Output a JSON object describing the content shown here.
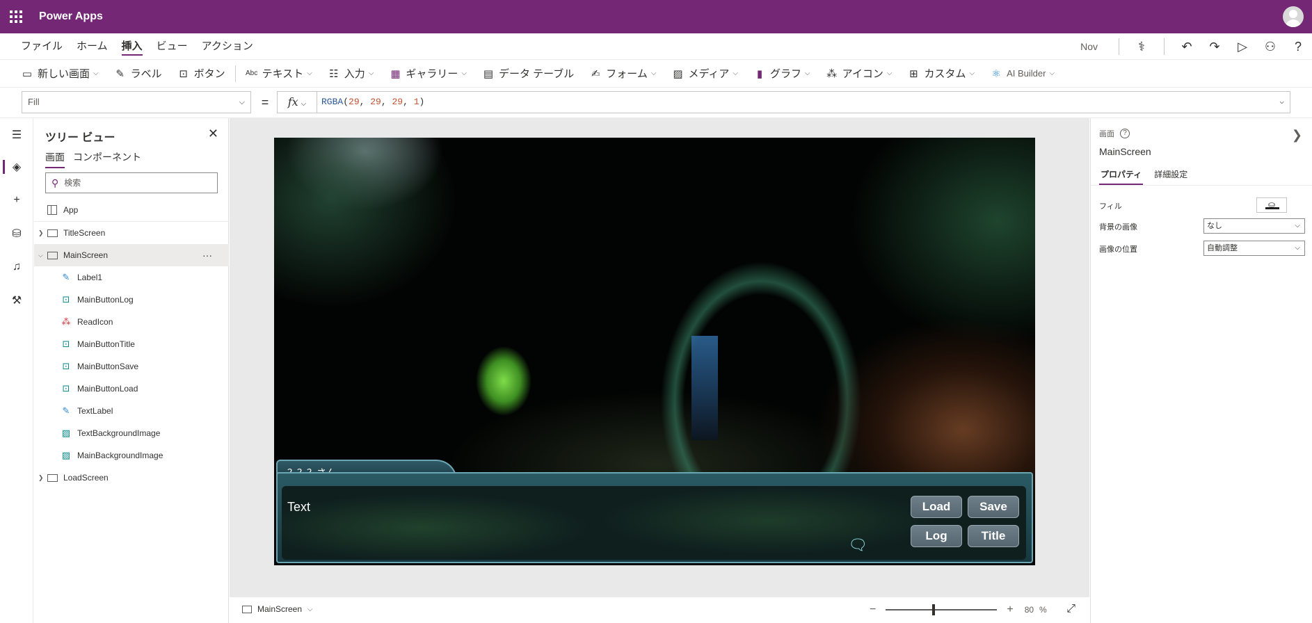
{
  "appbar": {
    "title": "Power Apps"
  },
  "menu": {
    "tabs": [
      {
        "label": "ファイル"
      },
      {
        "label": "ホーム"
      },
      {
        "label": "挿入"
      },
      {
        "label": "ビュー"
      },
      {
        "label": "アクション"
      }
    ],
    "active_tab": "挿入",
    "user": "Nov"
  },
  "ribbon": {
    "new_screen": "新しい画面",
    "label": "ラベル",
    "button": "ボタン",
    "text": "テキスト",
    "input": "入力",
    "gallery": "ギャラリー",
    "data_table": "データ テーブル",
    "form": "フォーム",
    "media": "メディア",
    "chart": "グラフ",
    "icons": "アイコン",
    "custom": "カスタム",
    "ai_builder": "AI Builder"
  },
  "formula": {
    "property": "Fill",
    "equals": "=",
    "fx": "fx",
    "fn": "RGBA",
    "args": [
      "29",
      "29",
      "29",
      "1"
    ]
  },
  "tree": {
    "title": "ツリー ビュー",
    "tabs": [
      {
        "label": "画面"
      },
      {
        "label": "コンポーネント"
      }
    ],
    "search_placeholder": "検索",
    "nodes": {
      "app": "App",
      "title_screen": "TitleScreen",
      "main_screen": "MainScreen",
      "label1": "Label1",
      "main_button_log": "MainButtonLog",
      "read_icon": "ReadIcon",
      "main_button_title": "MainButtonTitle",
      "main_button_save": "MainButtonSave",
      "main_button_load": "MainButtonLoad",
      "text_label": "TextLabel",
      "text_background_image": "TextBackgroundImage",
      "main_background_image": "MainBackgroundImage",
      "load_screen": "LoadScreen"
    }
  },
  "game": {
    "speaker": "？？？さん",
    "text": "Text",
    "buttons": {
      "load": "Load",
      "save": "Save",
      "log": "Log",
      "title": "Title"
    }
  },
  "status": {
    "screen": "MainScreen",
    "zoom_value": "80",
    "zoom_unit": "%",
    "zoom_level": 0.43
  },
  "props": {
    "kind": "画面",
    "name": "MainScreen",
    "tabs": [
      {
        "label": "プロパティ"
      },
      {
        "label": "詳細設定"
      }
    ],
    "fill_label": "フィル",
    "bg_image_label": "背景の画像",
    "bg_image_value": "なし",
    "image_position_label": "画像の位置",
    "image_position_value": "自動調整"
  },
  "colors": {
    "brand": "#742774",
    "screen_fill": "#1d1d1d"
  }
}
